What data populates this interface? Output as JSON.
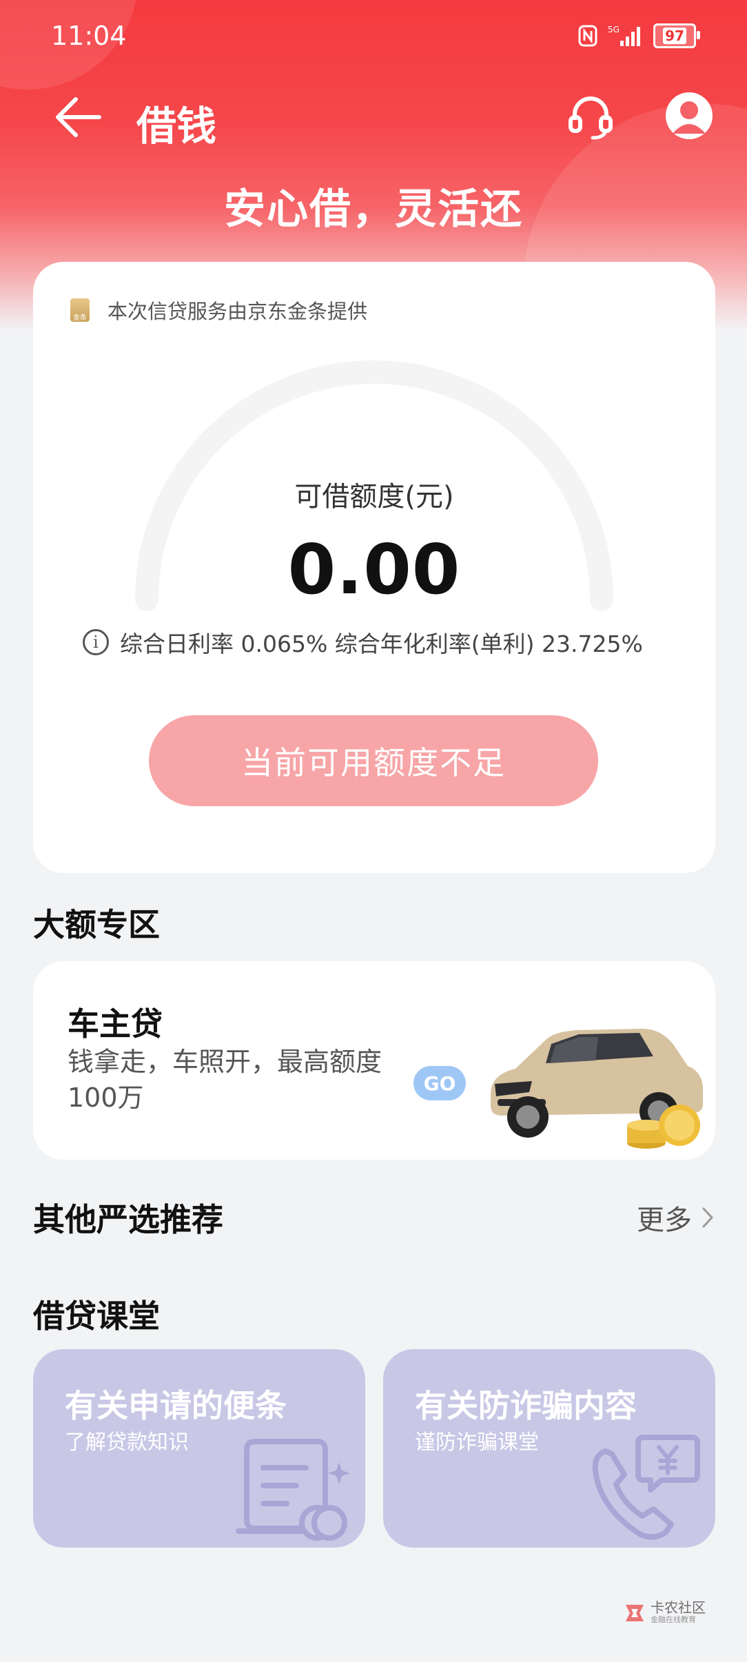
{
  "status_bar": {
    "time": "11:04",
    "network": "5G",
    "battery": "97"
  },
  "header": {
    "title": "借钱",
    "slogan": "安心借，灵活还"
  },
  "loan_card": {
    "provider_logo_text": "金条",
    "provider_text": "本次信贷服务由京东金条提供",
    "limit_label": "可借额度(元)",
    "limit_value": "0.00",
    "rate_text": "综合日利率 0.065% 综合年化利率(单利) 23.725%",
    "button_label": "当前可用额度不足"
  },
  "large_zone": {
    "section_title": "大额专区",
    "card_title": "车主贷",
    "card_desc": "钱拿走，车照开，最高额度100万",
    "go_label": "GO"
  },
  "recommend": {
    "section_title": "其他严选推荐",
    "more_label": "更多"
  },
  "classroom": {
    "section_title": "借贷课堂",
    "cards": [
      {
        "title": "有关申请的便条",
        "subtitle": "了解贷款知识",
        "icon": "document-icon"
      },
      {
        "title": "有关防诈骗内容",
        "subtitle": "谨防诈骗课堂",
        "icon": "phone-yuan-icon"
      }
    ]
  },
  "watermark": {
    "main": "卡农社区",
    "sub": "金融在线教育"
  },
  "colors": {
    "header_red": "#f43a3f",
    "button_pink": "#f7a5a7",
    "go_blue": "#9fc7f5",
    "class_card_purple": "#c9c7e6"
  }
}
